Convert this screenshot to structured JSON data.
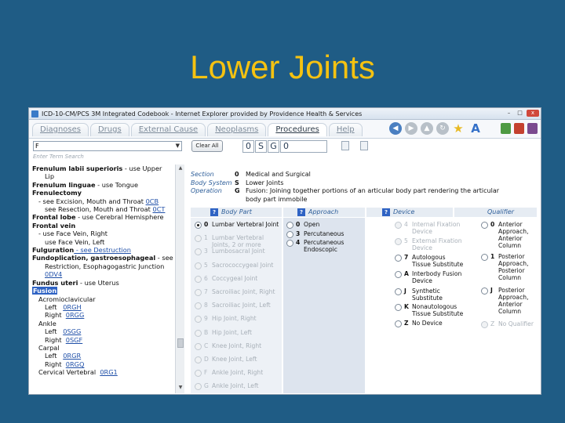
{
  "slide": {
    "title": "Lower Joints"
  },
  "window": {
    "title": "ICD-10-CM/PCS 3M Integrated Codebook - Internet Explorer provided by Providence Health & Services",
    "min": "–",
    "max": "□",
    "close": "x"
  },
  "tabs": [
    {
      "label": "Diagnoses",
      "active": false
    },
    {
      "label": "Drugs",
      "active": false
    },
    {
      "label": "External Cause",
      "active": false
    },
    {
      "label": "Neoplasms",
      "active": false
    },
    {
      "label": "Procedures",
      "active": true
    },
    {
      "label": "Help",
      "active": false
    }
  ],
  "toolbar_icons": [
    "back-arrow-icon",
    "forward-arrow-icon",
    "up-arrow-icon",
    "refresh-icon",
    "favorites-star-icon",
    "font-size-icon",
    "books-icon",
    "book-red-icon",
    "book-purple-icon"
  ],
  "search": {
    "dropdown_value": "F",
    "dropdown_arrow": "▼",
    "sub_hint": "Enter Term Search",
    "clear_all": "Clear All",
    "code": [
      "0",
      "S",
      "G"
    ],
    "code_rest": "0"
  },
  "index_lines": [
    {
      "parts": [
        {
          "t": "Frenulum labii superioris",
          "c": "b"
        },
        {
          "t": " - use Upper",
          "c": ""
        }
      ],
      "indent": ""
    },
    {
      "parts": [
        {
          "t": "Lip",
          "c": ""
        }
      ],
      "indent": "i2"
    },
    {
      "parts": [
        {
          "t": "Frenulum linguae",
          "c": "b"
        },
        {
          "t": " - use Tongue",
          "c": ""
        }
      ],
      "indent": ""
    },
    {
      "parts": [
        {
          "t": "Frenulectomy",
          "c": "b"
        }
      ],
      "indent": ""
    },
    {
      "parts": [
        {
          "t": "- see Excision, Mouth and Throat ",
          "c": ""
        },
        {
          "t": "0CB",
          "c": "lnk"
        }
      ],
      "indent": "i1"
    },
    {
      "parts": [
        {
          "t": "see Resection, Mouth and Throat ",
          "c": ""
        },
        {
          "t": "0CT",
          "c": "lnk"
        }
      ],
      "indent": "i2"
    },
    {
      "parts": [
        {
          "t": "Frontal lobe",
          "c": "b"
        },
        {
          "t": " - use Cerebral Hemisphere",
          "c": ""
        }
      ],
      "indent": ""
    },
    {
      "parts": [
        {
          "t": "Frontal vein",
          "c": "b"
        }
      ],
      "indent": ""
    },
    {
      "parts": [
        {
          "t": "- use Face Vein, Right",
          "c": ""
        }
      ],
      "indent": "i1"
    },
    {
      "parts": [
        {
          "t": "use Face Vein, Left",
          "c": ""
        }
      ],
      "indent": "i2"
    },
    {
      "parts": [
        {
          "t": "Fulguration",
          "c": "b"
        },
        {
          "t": " - see Destruction",
          "c": "lnk"
        }
      ],
      "indent": ""
    },
    {
      "parts": [
        {
          "t": "Fundoplication, gastroesophageal",
          "c": "b"
        },
        {
          "t": " - see",
          "c": ""
        }
      ],
      "indent": ""
    },
    {
      "parts": [
        {
          "t": "Restriction, Esophagogastric Junction",
          "c": ""
        }
      ],
      "indent": "i2"
    },
    {
      "parts": [
        {
          "t": "0DV4",
          "c": "lnk"
        }
      ],
      "indent": "i2"
    },
    {
      "parts": [
        {
          "t": "Fundus uteri",
          "c": "b"
        },
        {
          "t": " - use Uterus",
          "c": ""
        }
      ],
      "indent": ""
    },
    {
      "parts": [
        {
          "t": "Fusion",
          "c": "selected"
        }
      ],
      "indent": ""
    },
    {
      "parts": [
        {
          "t": "Acromioclavicular",
          "c": ""
        }
      ],
      "indent": "i1"
    },
    {
      "parts": [
        {
          "t": "Left   ",
          "c": ""
        },
        {
          "t": "0RGH",
          "c": "lnk"
        }
      ],
      "indent": "i2"
    },
    {
      "parts": [
        {
          "t": "Right  ",
          "c": ""
        },
        {
          "t": "0RGG",
          "c": "lnk"
        }
      ],
      "indent": "i2"
    },
    {
      "parts": [
        {
          "t": "Ankle",
          "c": ""
        }
      ],
      "indent": "i1"
    },
    {
      "parts": [
        {
          "t": "Left   ",
          "c": ""
        },
        {
          "t": "0SGG",
          "c": "lnk"
        }
      ],
      "indent": "i2"
    },
    {
      "parts": [
        {
          "t": "Right  ",
          "c": ""
        },
        {
          "t": "0SGF",
          "c": "lnk"
        }
      ],
      "indent": "i2"
    },
    {
      "parts": [
        {
          "t": "Carpal",
          "c": ""
        }
      ],
      "indent": "i1"
    },
    {
      "parts": [
        {
          "t": "Left   ",
          "c": ""
        },
        {
          "t": "0RGR",
          "c": "lnk"
        }
      ],
      "indent": "i2"
    },
    {
      "parts": [
        {
          "t": "Right  ",
          "c": ""
        },
        {
          "t": "0RGQ",
          "c": "lnk"
        }
      ],
      "indent": "i2"
    },
    {
      "parts": [
        {
          "t": "Cervical Vertebral  ",
          "c": ""
        },
        {
          "t": "0RG1",
          "c": "lnk"
        }
      ],
      "indent": "i1"
    }
  ],
  "table_rows": [
    {
      "label": "Section",
      "code": "0",
      "desc": "Medical and Surgical"
    },
    {
      "label": "Body System",
      "code": "S",
      "desc": "Lower Joints"
    },
    {
      "label": "Operation",
      "code": "G",
      "desc": "Fusion: Joining together portions of an articular body part rendering the articular"
    },
    {
      "label": "",
      "code": "",
      "desc": "body part immobile"
    }
  ],
  "columns": {
    "body_part": "Body Part",
    "approach": "Approach",
    "device": "Device",
    "qualifier": "Qualifier",
    "badge": "?"
  },
  "body_parts": [
    {
      "code": "0",
      "text": "Lumbar Vertebral Joint",
      "sel": true,
      "dis": false
    },
    {
      "code": "1",
      "text": "Lumbar Vertebral Joints, 2 or more",
      "sel": false,
      "dis": true
    },
    {
      "code": "3",
      "text": "Lumbosacral Joint",
      "sel": false,
      "dis": true
    },
    {
      "code": "5",
      "text": "Sacrococcygeal Joint",
      "sel": false,
      "dis": true
    },
    {
      "code": "6",
      "text": "Coccygeal Joint",
      "sel": false,
      "dis": true
    },
    {
      "code": "7",
      "text": "Sacroiliac Joint, Right",
      "sel": false,
      "dis": true
    },
    {
      "code": "8",
      "text": "Sacroiliac Joint, Left",
      "sel": false,
      "dis": true
    },
    {
      "code": "9",
      "text": "Hip Joint, Right",
      "sel": false,
      "dis": true
    },
    {
      "code": "B",
      "text": "Hip Joint, Left",
      "sel": false,
      "dis": true
    },
    {
      "code": "C",
      "text": "Knee Joint, Right",
      "sel": false,
      "dis": true
    },
    {
      "code": "D",
      "text": "Knee Joint, Left",
      "sel": false,
      "dis": true
    },
    {
      "code": "F",
      "text": "Ankle Joint, Right",
      "sel": false,
      "dis": true
    },
    {
      "code": "G",
      "text": "Ankle Joint, Left",
      "sel": false,
      "dis": true
    }
  ],
  "approaches": [
    {
      "code": "0",
      "text": "Open"
    },
    {
      "code": "3",
      "text": "Percutaneous"
    },
    {
      "code": "4",
      "text": "Percutaneous Endoscopic"
    }
  ],
  "devices": [
    {
      "code": "4",
      "text": "Internal Fixation Device",
      "dis": true
    },
    {
      "code": "5",
      "text": "External Fixation Device",
      "dis": true
    },
    {
      "code": "7",
      "text": "Autologous Tissue Substitute",
      "dis": false
    },
    {
      "code": "A",
      "text": "Interbody Fusion Device",
      "dis": false
    },
    {
      "code": "J",
      "text": "Synthetic Substitute",
      "dis": false
    },
    {
      "code": "K",
      "text": "Nonautologous Tissue Substitute",
      "dis": false
    },
    {
      "code": "Z",
      "text": "No Device",
      "dis": false
    }
  ],
  "qualifiers": [
    {
      "code": "0",
      "text": "Anterior Approach, Anterior Column",
      "dis": false
    },
    {
      "code": "1",
      "text": "Posterior Approach, Posterior Column",
      "dis": false
    },
    {
      "code": "J",
      "text": "Posterior Approach, Anterior Column",
      "dis": false
    },
    {
      "code": "Z",
      "text": "No Qualifier",
      "dis": true
    }
  ],
  "colors": {
    "slide_bg": "#1f5c85",
    "title": "#f5c211",
    "link": "#1f4fa8",
    "selected": "#2f63c4"
  }
}
